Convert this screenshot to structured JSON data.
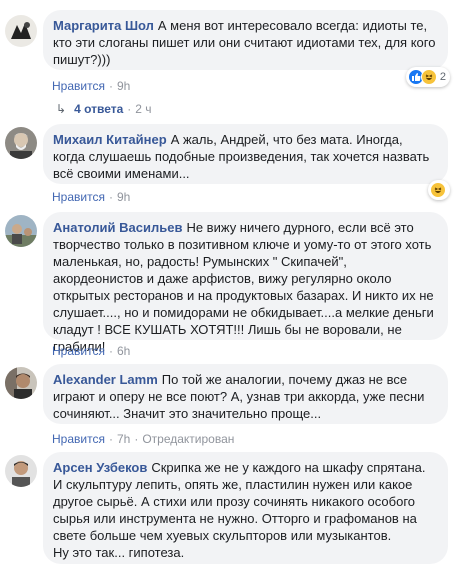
{
  "comments": [
    {
      "author": "Маргарита Шол",
      "text": "А меня вот интересовало всегда: идиоты те, кто эти слоганы пишет или они считают идиотами тех, для кого пишут?)))",
      "like_label": "Нравится",
      "time": "9h",
      "reactions": {
        "icons": [
          "like-icon",
          "haha-icon"
        ],
        "count": "2"
      },
      "replies": {
        "label": "4 ответа",
        "time": "2 ч"
      }
    },
    {
      "author": "Михаил Китайнер",
      "text": "А жаль, Андрей, что без мата. Иногда, когда слушаешь подобные произведения, так хочется назвать всё своими именами...",
      "like_label": "Нравится",
      "time": "9h",
      "reactions": {
        "icons": [
          "haha-icon"
        ],
        "count": ""
      }
    },
    {
      "author": "Анатолий Васильев",
      "text": "Не вижу ничего дурного, если всё это творчество только в позитивном ключе и уому-то от этого хоть маленькая, но, радость! Румынских \" Скипачей\", акордеонистов и даже арфистов, вижу регулярно около открытых ресторанов и на продуктовых базарах. И никто их не слушает...., но и помидорами не обкидывает....а мелкие деньги кладут ! ВСЕ КУШАТЬ ХОТЯТ!!! Лишь бы не воровали, не грабили!",
      "like_label": "Нравится",
      "time": "6h"
    },
    {
      "author": "Alexander Lamm",
      "text": "По той же аналогии, почему джаз не все играют и оперу не все поют? А, узнав три аккорда, уже песни сочиняют... Значит это значительно проще...",
      "like_label": "Нравится",
      "time": "7h",
      "edited": "Отредактирован"
    },
    {
      "author": "Арсен Узбеков",
      "text": "Скрипка же не у каждого на шкафу спрятана. И скульптуру лепить, опять же, пластилин нужен или какое другое сырьё. А стихи или прозу сочинять никакого особого сырья или инструмента не нужно. Отторго и графоманов на свете больше чем хуевых скульпторов или музыкантов.\nНу это так... гипотеза."
    }
  ],
  "colors": {
    "author": "#385898",
    "link": "#4267b2",
    "bubble": "#f2f3f5",
    "meta": "#90949c"
  }
}
